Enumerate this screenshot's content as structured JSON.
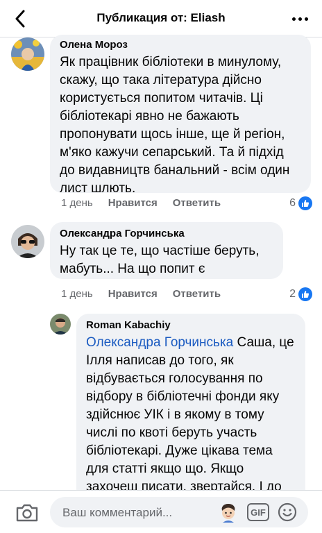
{
  "header": {
    "title": "Публикация от: Eliash"
  },
  "comments": [
    {
      "author": "Олена Мороз",
      "text": "Як працівник бібліотеки в минулому, скажу, що така література дійсно користується попитом читачів. Ці бібліотекарі явно не бажають пропонувати щось інше, ще й регіон, м'яко кажучи сепарський. Та й підхід до видавництв банальний - всім один лист шлють.",
      "time": "1 день",
      "like_label": "Нравится",
      "reply_label": "Ответить",
      "reactions": "6"
    },
    {
      "author": "Олександра Горчинська",
      "text": "Ну так це те, що частіше беруть, мабуть... На що попит є",
      "time": "1 день",
      "like_label": "Нравится",
      "reply_label": "Ответить",
      "reactions": "2"
    },
    {
      "author": "Roman Kabachiy",
      "mention": "Олександра Горчинська",
      "text": " Саша, це Ілля написав до того, як відбувається голосування по відбору в бібліотечні фонди яку здійснює УІК і в якому в тому числі по квоті беруть участь бібліотекарі. Дуже цікава тема для статті якщо що. Якщо захочеш писати, звертайся. І до"
    }
  ],
  "composer": {
    "placeholder": "Ваш комментарий...",
    "gif_label": "GIF"
  },
  "colors": {
    "bubble": "#f0f2f5",
    "mention": "#1b5bc1",
    "like": "#1877f2",
    "secondary_text": "#65676b"
  }
}
